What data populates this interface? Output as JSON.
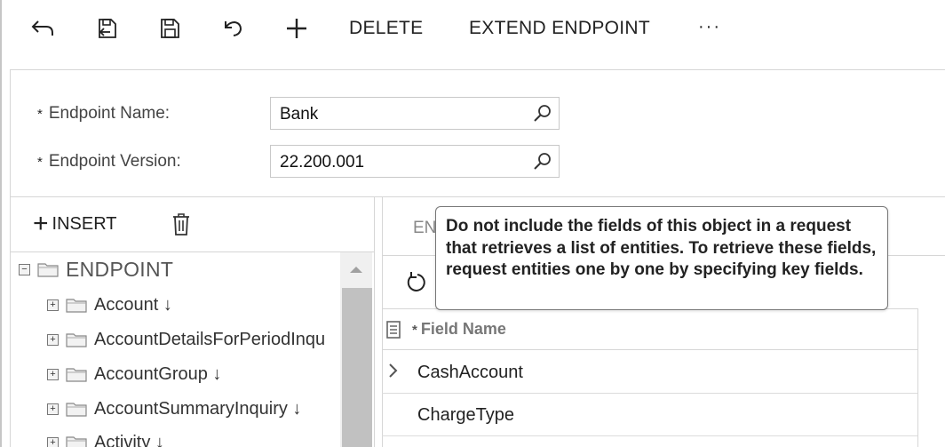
{
  "toolbar": {
    "back_icon": "back-arrow-icon",
    "save_close_icon": "save-and-close-icon",
    "save_icon": "save-icon",
    "undo_icon": "undo-icon",
    "add_icon": "plus-icon",
    "delete_label": "DELETE",
    "extend_label": "EXTEND ENDPOINT",
    "more_label": "···"
  },
  "form": {
    "endpoint_name": {
      "required_mark": "*",
      "label": "Endpoint Name:",
      "value": "Bank"
    },
    "endpoint_version": {
      "required_mark": "*",
      "label": "Endpoint Version:",
      "value": "22.200.001"
    }
  },
  "tree_panel": {
    "insert_label": "INSERT",
    "root": {
      "label": "ENDPOINT",
      "expander": "⊟"
    },
    "items": [
      {
        "label": "Account ↓",
        "expander": "+"
      },
      {
        "label": "AccountDetailsForPeriodInqu",
        "expander": "+"
      },
      {
        "label": "AccountGroup ↓",
        "expander": "+"
      },
      {
        "label": "AccountSummaryInquiry ↓",
        "expander": "+"
      },
      {
        "label": "Activity ↓",
        "expander": "+"
      }
    ]
  },
  "fields_panel": {
    "tab_partial": "EN",
    "column_header": {
      "required_mark": "*",
      "label": "Field Name"
    },
    "rows": [
      {
        "field_name": "CashAccount"
      },
      {
        "field_name": "ChargeType"
      }
    ]
  },
  "tooltip": {
    "text": "Do not include the fields of this object in a request that retrieves a list of entities. To retrieve these fields, request entities one by one by specifying key fields."
  }
}
